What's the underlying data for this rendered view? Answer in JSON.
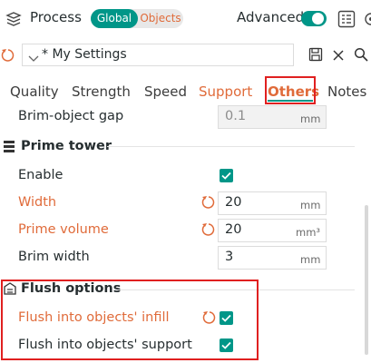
{
  "header": {
    "title": "Process",
    "mode_global": "Global",
    "mode_objects": "Objects",
    "advanced_label": "Advanced",
    "advanced_on": true
  },
  "preset": {
    "name": "* My Settings"
  },
  "tabs": [
    {
      "label": "Quality",
      "state": "normal"
    },
    {
      "label": "Strength",
      "state": "normal"
    },
    {
      "label": "Speed",
      "state": "normal"
    },
    {
      "label": "Support",
      "state": "modified"
    },
    {
      "label": "Others",
      "state": "active"
    },
    {
      "label": "Notes",
      "state": "normal"
    }
  ],
  "brim_gap": {
    "label": "Brim-object gap",
    "value": "0.1",
    "unit": "mm"
  },
  "prime_tower": {
    "title": "Prime tower",
    "enable_label": "Enable",
    "enable_checked": true,
    "width": {
      "label": "Width",
      "value": "20",
      "unit": "mm"
    },
    "prime_volume": {
      "label": "Prime volume",
      "value": "20",
      "unit": "mm³"
    },
    "brim_width": {
      "label": "Brim width",
      "value": "3",
      "unit": "mm"
    }
  },
  "flush": {
    "title": "Flush options",
    "infill_label": "Flush into objects' infill",
    "infill_checked": true,
    "support_label": "Flush into objects' support",
    "support_checked": true
  },
  "colors": {
    "accent": "#009688",
    "modified": "#e06b3a",
    "highlight": "#e02020"
  }
}
